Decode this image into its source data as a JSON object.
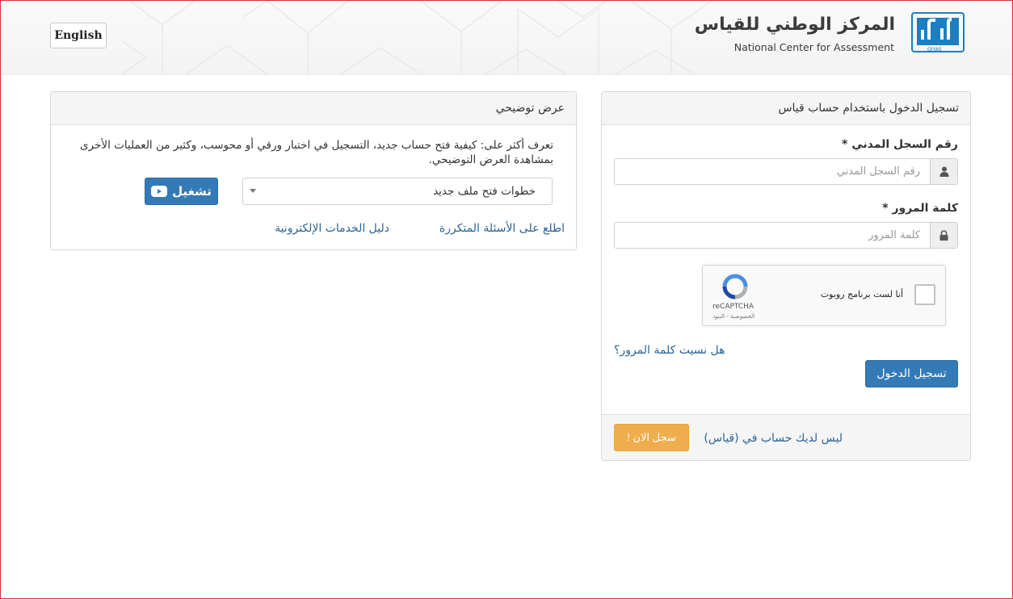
{
  "header": {
    "lang_button": "English",
    "logo_arabic": "المركز الوطني للقياس",
    "logo_english": "National Center for Assessment",
    "logo_mark_text": "QIYAS"
  },
  "login": {
    "title": "تسجيل الدخول باستخدام حساب قياس",
    "id_label": "رقم السجل المدني *",
    "id_placeholder": "رقم السجل المدني",
    "id_icon": "user-icon",
    "password_label": "كلمة المرور *",
    "password_placeholder": "كلمة المرور",
    "password_icon": "lock-icon",
    "captcha_label": "أنا لست برنامج روبوت",
    "captcha_brand": "reCAPTCHA",
    "captcha_links": "الخصوصية - البنود",
    "forgot_link": "هل نسيت كلمة المرور؟",
    "submit_button": "تسجيل الدخول",
    "no_account_text": "ليس لديك حساب في (قياس)",
    "register_button": "سجل الان !"
  },
  "demo": {
    "title": "عرض توضيحي",
    "description": "تعرف أكثر على: كيفية فتح حساب جديد، التسجيل في اختبار ورقي أو محوسب، وكثير من العمليات الأخرى بمشاهدة العرض التوضيحي.",
    "select_value": "خطوات فتح ملف جديد",
    "play_button": "تشغيل",
    "play_icon": "youtube-play-icon",
    "faq_link": "اطلع على الأسئلة المتكررة",
    "eservices_link": "دليل الخدمات الإلكترونية"
  },
  "colors": {
    "primary": "#337ab7",
    "warning": "#f0ad4e",
    "link": "#2a6496",
    "logo_blue": "#1d7fc1"
  }
}
